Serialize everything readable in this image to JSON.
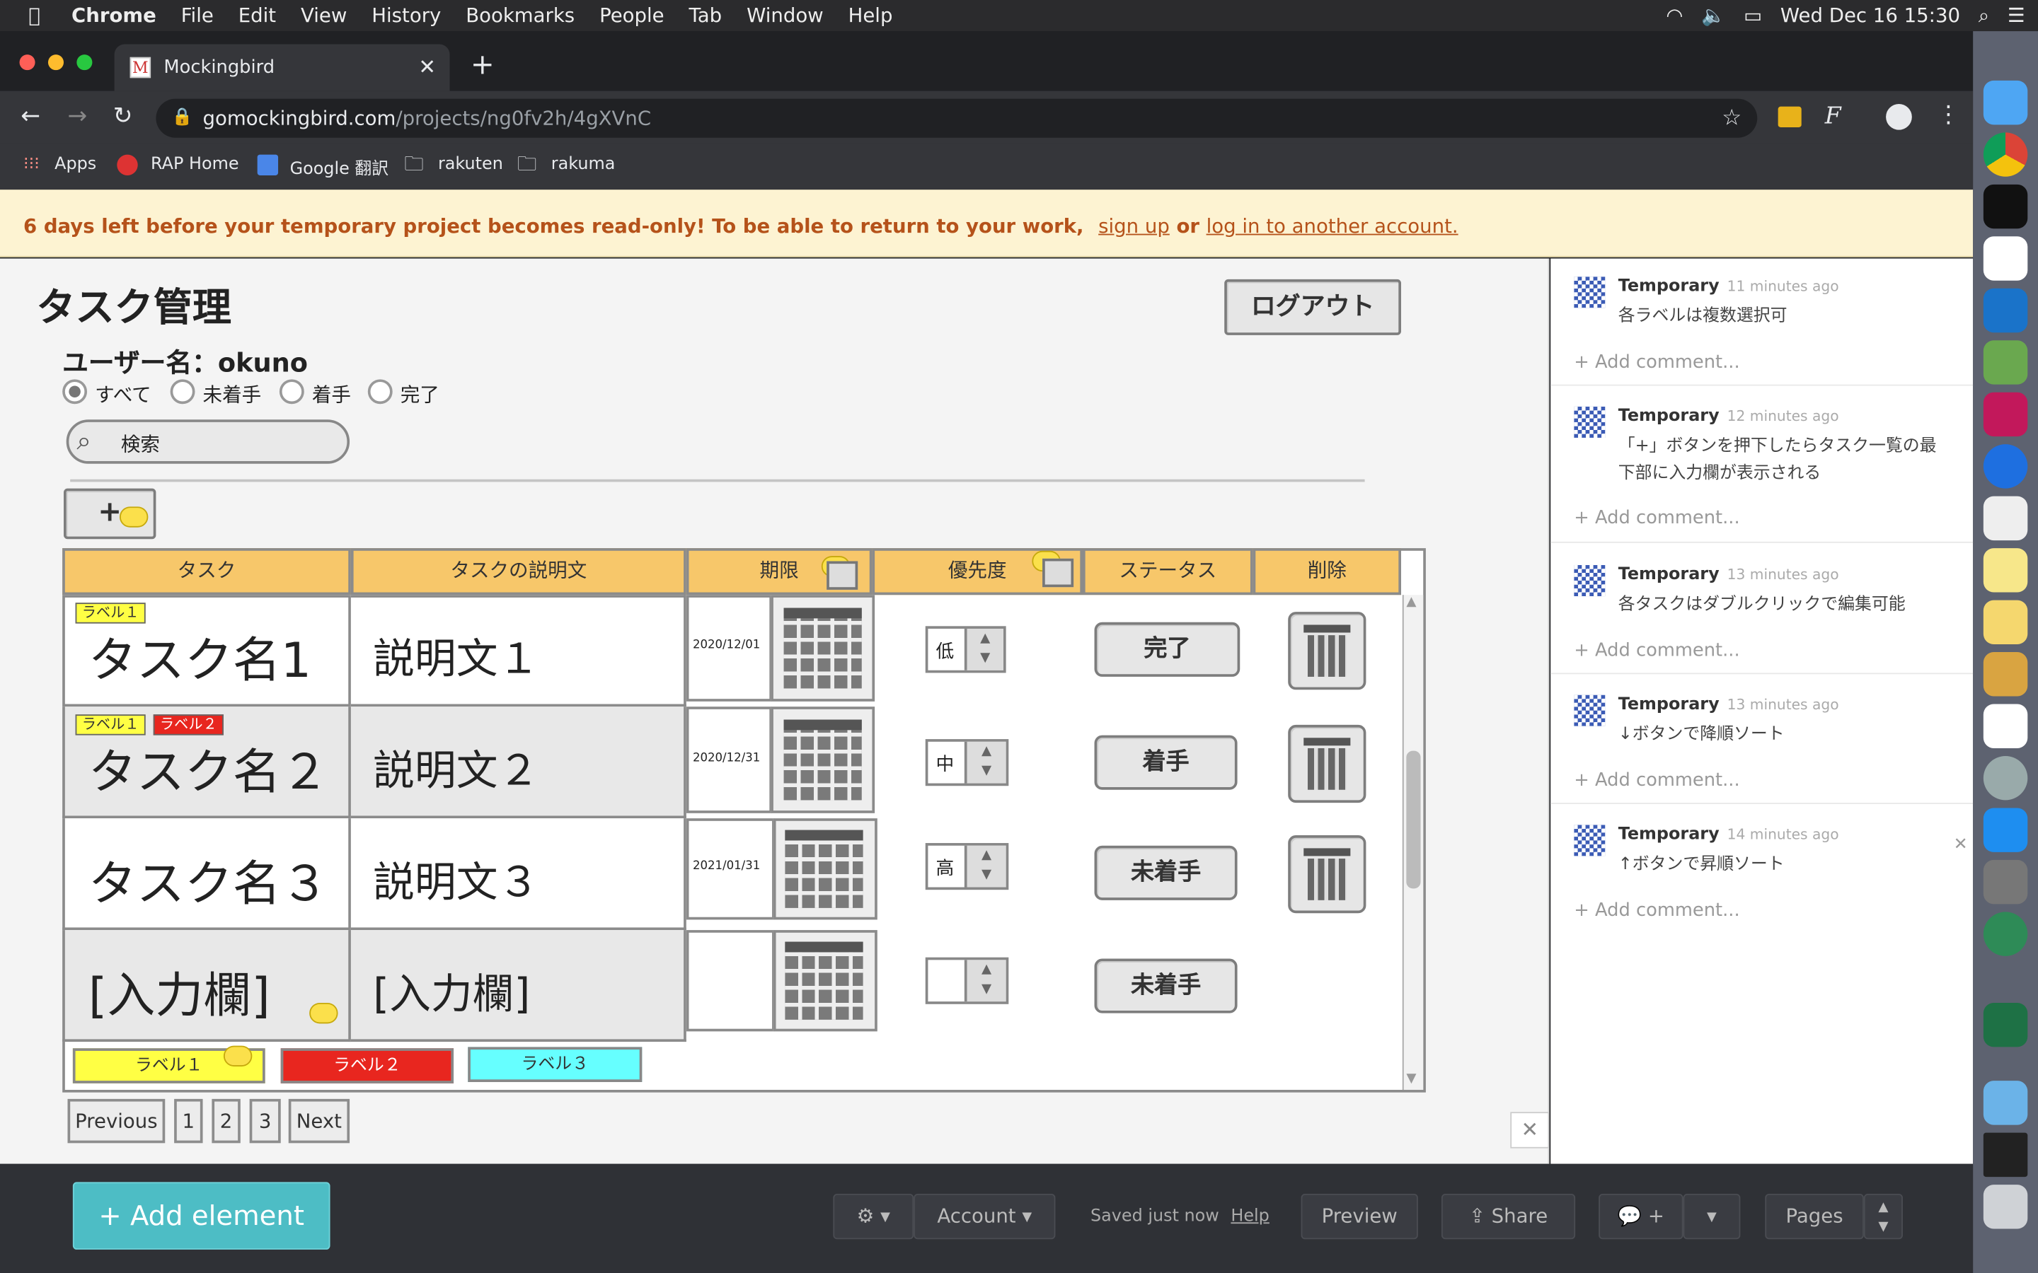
{
  "menubar": {
    "app": "Chrome",
    "items": [
      "File",
      "Edit",
      "View",
      "History",
      "Bookmarks",
      "People",
      "Tab",
      "Window",
      "Help"
    ],
    "clock": "Wed Dec 16  15:30"
  },
  "browser": {
    "tab_title": "Mockingbird",
    "url_host": "gomockingbird.com",
    "url_path": "/projects/ng0fv2h/4gXVnC",
    "bookmarks": [
      "Apps",
      "RAP Home",
      "Google 翻訳",
      "rakuten",
      "rakuma"
    ]
  },
  "banner": {
    "text": "6 days left before your temporary project becomes read-only! To be able to return to your work,",
    "signup": "sign up",
    "or": "or",
    "login": "log in to another account."
  },
  "mock": {
    "title": "タスク管理",
    "logout": "ログアウト",
    "username": "ユーザー名：okuno",
    "filters": [
      "すべて",
      "未着手",
      "着手",
      "完了"
    ],
    "search_placeholder": "検索",
    "add": "+",
    "headers": [
      "タスク",
      "タスクの説明文",
      "期限",
      "優先度",
      "ステータス",
      "削除"
    ],
    "rows": [
      {
        "name": "タスク名1",
        "desc": "説明文１",
        "date": "2020/12/01",
        "priority": "低",
        "status": "完了",
        "labels": [
          "ラベル１"
        ]
      },
      {
        "name": "タスク名２",
        "desc": "説明文２",
        "date": "2020/12/31",
        "priority": "中",
        "status": "着手",
        "labels": [
          "ラベル１",
          "ラベル２"
        ]
      },
      {
        "name": "タスク名３",
        "desc": "説明文３",
        "date": "2021/01/31",
        "priority": "高",
        "status": "未着手",
        "labels": []
      },
      {
        "name": "[入力欄]",
        "desc": "[入力欄]",
        "date": "",
        "priority": "",
        "status": "未着手",
        "labels": []
      }
    ],
    "label_chips": [
      "ラベル１",
      "ラベル２",
      "ラベル３"
    ],
    "pagination": [
      "Previous",
      "1",
      "2",
      "3",
      "Next"
    ]
  },
  "comments": [
    {
      "author": "Temporary",
      "time": "11 minutes ago",
      "text": "各ラベルは複数選択可"
    },
    {
      "author": "Temporary",
      "time": "12 minutes ago",
      "text": "「+」ボタンを押下したらタスク一覧の最下部に入力欄が表示される"
    },
    {
      "author": "Temporary",
      "time": "13 minutes ago",
      "text": "各タスクはダブルクリックで編集可能"
    },
    {
      "author": "Temporary",
      "time": "13 minutes ago",
      "text": "↓ボタンで降順ソート"
    },
    {
      "author": "Temporary",
      "time": "14 minutes ago",
      "text": "↑ボタンで昇順ソート"
    }
  ],
  "add_comment": "Add comment...",
  "bottom": {
    "add_element": "+ Add element",
    "account": "Account",
    "saved": "Saved just now",
    "help": "Help",
    "preview": "Preview",
    "share": "Share",
    "pages": "Pages",
    "comment_plus": "+"
  },
  "colors": {
    "header": "#f7c76a",
    "label1": "#ffff44",
    "label2": "#e8261f",
    "label3": "#66ffff",
    "add_element": "#4dbdc5"
  }
}
